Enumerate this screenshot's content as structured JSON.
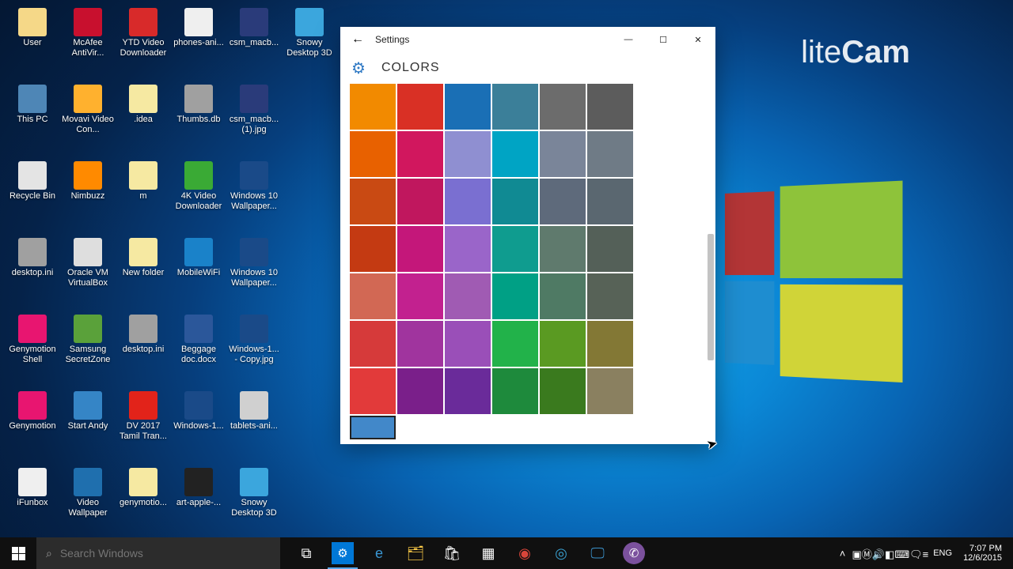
{
  "watermark": "liteCam",
  "desktop_icons": [
    {
      "label": "User",
      "bg": "#f5d888"
    },
    {
      "label": "McAfee AntiVir...",
      "bg": "#c8102e"
    },
    {
      "label": "YTD Video Downloader",
      "bg": "#d82a2a"
    },
    {
      "label": "phones-ani...",
      "bg": "#efefef"
    },
    {
      "label": "csm_macb...",
      "bg": "#2a3b7a"
    },
    {
      "label": "Snowy Desktop 3D",
      "bg": "#3ba6dd"
    },
    {
      "label": "This PC",
      "bg": "#4e86b6"
    },
    {
      "label": "Movavi Video Con...",
      "bg": "#ffb12e"
    },
    {
      "label": ".idea",
      "bg": "#f6e9a2"
    },
    {
      "label": "Thumbs.db",
      "bg": "#a0a0a0"
    },
    {
      "label": "csm_macb... (1).jpg",
      "bg": "#2a3b7a"
    },
    {
      "label": ""
    },
    {
      "label": "Recycle Bin",
      "bg": "#e4e4e4"
    },
    {
      "label": "Nimbuzz",
      "bg": "#ff8a00"
    },
    {
      "label": "m",
      "bg": "#f6e9a2"
    },
    {
      "label": "4K Video Downloader",
      "bg": "#3aaa35"
    },
    {
      "label": "Windows 10 Wallpaper...",
      "bg": "#1a4a88"
    },
    {
      "label": ""
    },
    {
      "label": "desktop.ini",
      "bg": "#a0a0a0"
    },
    {
      "label": "Oracle VM VirtualBox",
      "bg": "#dedede"
    },
    {
      "label": "New folder",
      "bg": "#f6e9a2"
    },
    {
      "label": "MobileWiFi",
      "bg": "#1a82c9"
    },
    {
      "label": "Windows 10 Wallpaper...",
      "bg": "#1a4a88"
    },
    {
      "label": ""
    },
    {
      "label": "Genymotion Shell",
      "bg": "#e81570"
    },
    {
      "label": "Samsung SecretZone",
      "bg": "#5aa13a"
    },
    {
      "label": "desktop.ini",
      "bg": "#a0a0a0"
    },
    {
      "label": "Beggage doc.docx",
      "bg": "#2b579a"
    },
    {
      "label": "Windows-1... - Copy.jpg",
      "bg": "#1a4a88"
    },
    {
      "label": ""
    },
    {
      "label": "Genymotion",
      "bg": "#e81570"
    },
    {
      "label": "Start Andy",
      "bg": "#3585c6"
    },
    {
      "label": "DV 2017 Tamil Tran...",
      "bg": "#e2231a"
    },
    {
      "label": "Windows-1...",
      "bg": "#1a4a88"
    },
    {
      "label": "tablets-ani...",
      "bg": "#d0d0d0"
    },
    {
      "label": ""
    },
    {
      "label": "iFunbox",
      "bg": "#efefef"
    },
    {
      "label": "Video Wallpaper",
      "bg": "#1f6fae"
    },
    {
      "label": "genymotio...",
      "bg": "#f6e9a2"
    },
    {
      "label": "art-apple-...",
      "bg": "#222"
    },
    {
      "label": "Snowy Desktop 3D",
      "bg": "#3ba6dd"
    },
    {
      "label": ""
    }
  ],
  "settings": {
    "title": "Settings",
    "back_glyph": "←",
    "min_glyph": "—",
    "max_glyph": "☐",
    "close_glyph": "✕",
    "gear_glyph": "⚙",
    "heading": "COLORS",
    "swatches": [
      "#f28a00",
      "#d93025",
      "#1a6fb5",
      "#3b7f99",
      "#6c6c6c",
      "#5c5c5c",
      "#e86100",
      "#d1175e",
      "#8f8fd1",
      "#00a4c4",
      "#7a8599",
      "#6f7b86",
      "#c94a13",
      "#c0175e",
      "#7a6fd1",
      "#108a93",
      "#5e6a7b",
      "#5a6770",
      "#c43a12",
      "#c4177a",
      "#9a65c9",
      "#0f9c8f",
      "#5f7a6d",
      "#546058",
      "#d26854",
      "#c2218f",
      "#a05bb3",
      "#00a085",
      "#4f7a64",
      "#576257",
      "#d63a3a",
      "#a0349e",
      "#9a4fb8",
      "#22b24a",
      "#5a9a22",
      "#837835",
      "#e23a3a",
      "#7a1f8a",
      "#6a2b9a",
      "#1e8a3c",
      "#3a7a1e",
      "#8a8060",
      "#4288c9"
    ],
    "selected_index": 42,
    "last_half": true
  },
  "taskbar": {
    "search_placeholder": "Search Windows",
    "search_glyph": "⌕",
    "icons": [
      {
        "name": "task-view",
        "glyph": "⧉",
        "active": false
      },
      {
        "name": "settings-app",
        "glyph": "⚙",
        "active": true,
        "bg": "#0078d7"
      },
      {
        "name": "edge",
        "glyph": "e",
        "active": false,
        "color": "#3a97d4"
      },
      {
        "name": "file-explorer",
        "glyph": "🗂",
        "active": false,
        "color": "#f5c646"
      },
      {
        "name": "store",
        "glyph": "🛍",
        "active": false
      },
      {
        "name": "apps-grid",
        "glyph": "▦",
        "active": false
      },
      {
        "name": "chrome",
        "glyph": "◉",
        "active": false,
        "color": "#d9453a"
      },
      {
        "name": "opera",
        "glyph": "◎",
        "active": false,
        "color": "#3aa0d0"
      },
      {
        "name": "monitor",
        "glyph": "🖵",
        "active": false,
        "color": "#3a90c8"
      },
      {
        "name": "viber",
        "glyph": "✆",
        "active": false,
        "bg": "#7b519d",
        "round": true
      }
    ]
  },
  "tray": {
    "up_glyph": "˄",
    "icons": [
      "▣",
      "Ⓜ",
      "🔊",
      "◧",
      "⌨",
      "🗨",
      "≡"
    ],
    "lang": "ENG",
    "time": "7:07 PM",
    "date": "12/6/2015"
  }
}
